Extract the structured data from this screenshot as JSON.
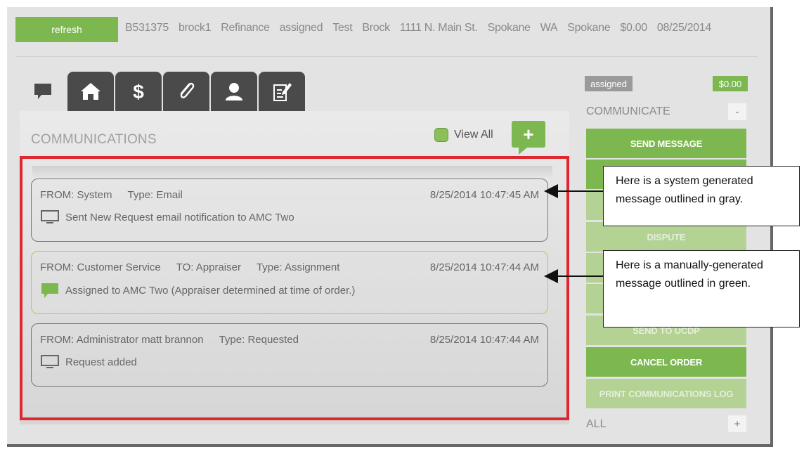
{
  "header": {
    "refresh_label": "refresh",
    "info": [
      "B531375",
      "brock1",
      "Refinance",
      "assigned",
      "Test",
      "Brock",
      "1111 N. Main St.",
      "Spokane",
      "WA",
      "Spokane",
      "$0.00",
      "08/25/2014"
    ]
  },
  "tabs": [
    {
      "icon": "message-icon",
      "active": true
    },
    {
      "icon": "home-icon",
      "active": false
    },
    {
      "icon": "dollar-icon",
      "active": false
    },
    {
      "icon": "paperclip-icon",
      "active": false
    },
    {
      "icon": "user-icon",
      "active": false
    },
    {
      "icon": "edit-note-icon",
      "active": false
    }
  ],
  "communications": {
    "title": "COMMUNICATIONS",
    "view_all_label": "View All",
    "add_label": "+",
    "messages": [
      {
        "from": "FROM: System",
        "to": "",
        "type": "Type: Email",
        "date": "8/25/2014 10:47:45 AM",
        "text": "Sent New Request email notification to AMC Two",
        "icon": "monitor-icon",
        "outline": "gray"
      },
      {
        "from": "FROM: Customer Service",
        "to": "TO: Appraiser",
        "type": "Type: Assignment",
        "date": "8/25/2014 10:47:44 AM",
        "text": "Assigned to AMC Two (Appraiser determined at time of order.)",
        "icon": "chat-bubble-icon",
        "outline": "green"
      },
      {
        "from": "FROM: Administrator matt brannon",
        "to": "",
        "type": "Type: Requested",
        "date": "8/25/2014 10:47:44 AM",
        "text": "Request added",
        "icon": "monitor-icon",
        "outline": "gray"
      }
    ]
  },
  "sidebar": {
    "status": "assigned",
    "amount": "$0.00",
    "communicate_title": "COMMUNICATE",
    "communicate_toggle": "-",
    "send_message": "SEND MESSAGE",
    "dispute": "DISPUTE",
    "send_to_ucdp": "SEND TO UCDP",
    "cancel_order": "CANCEL ORDER",
    "print_log": "PRINT COMMUNICATIONS LOG",
    "all_title": "ALL",
    "all_toggle": "+"
  },
  "callouts": {
    "system": "Here is a system generated message outlined in gray.",
    "manual": "Here is a manually-generated message outlined in green."
  },
  "colors": {
    "accent_green": "#7cb84f",
    "highlight_red": "#e0262e",
    "tab_dark": "#4a4a4a"
  }
}
